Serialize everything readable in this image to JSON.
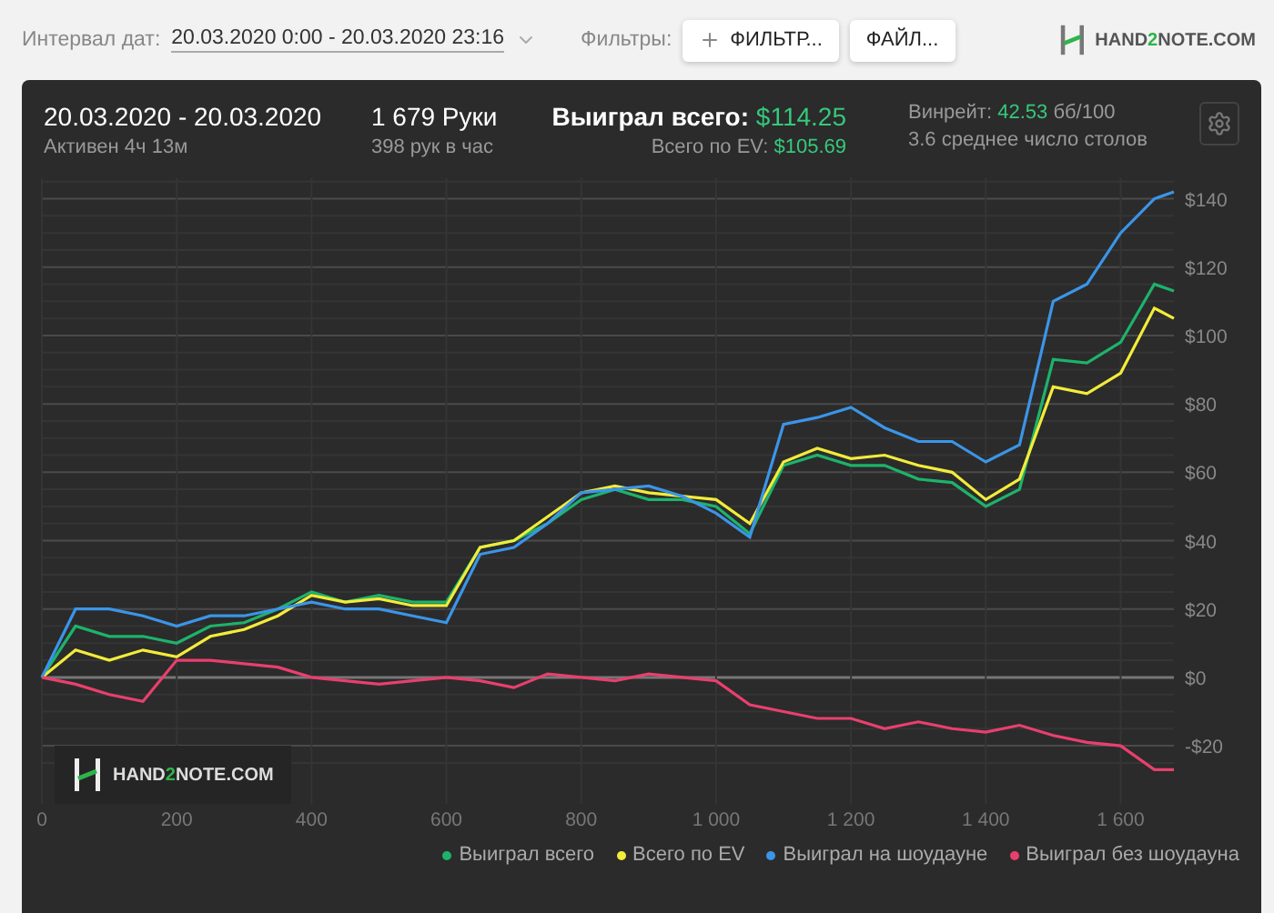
{
  "toolbar": {
    "date_label": "Интервал дат:",
    "date_value": "20.03.2020 0:00 - 20.03.2020 23:16",
    "filters_label": "Фильтры:",
    "filter_button": "ФИЛЬТР...",
    "file_button": "ФАЙЛ..."
  },
  "logo": {
    "before": "HAND",
    "accent": "2",
    "after": "NOTE.COM"
  },
  "summary": {
    "period": "20.03.2020 - 20.03.2020",
    "active": "Активен 4ч 13м",
    "hands": "1 679 Руки",
    "hands_rate": "398 рук в час",
    "won_label": "Выиграл всего:",
    "won_value": "$114.25",
    "ev_label": "Всего по EV:",
    "ev_value": "$105.69",
    "winrate_label": "Винрейт:",
    "winrate_value": "42.53",
    "winrate_unit": "бб/100",
    "tables": "3.6 среднее число столов"
  },
  "chart_watermark": {
    "before": "HAND",
    "accent": "2",
    "after": "NOTE.COM"
  },
  "chart_data": {
    "type": "line",
    "x": [
      0,
      50,
      100,
      150,
      200,
      250,
      300,
      350,
      400,
      450,
      500,
      550,
      600,
      650,
      700,
      750,
      800,
      850,
      900,
      950,
      1000,
      1050,
      1100,
      1150,
      1200,
      1250,
      1300,
      1350,
      1400,
      1450,
      1500,
      1550,
      1600,
      1650,
      1679
    ],
    "xlim": [
      0,
      1679
    ],
    "ylim": [
      -37,
      146
    ],
    "grid": true,
    "xticks": [
      {
        "value": 0,
        "label": "0"
      },
      {
        "value": 200,
        "label": "200"
      },
      {
        "value": 400,
        "label": "400"
      },
      {
        "value": 600,
        "label": "600"
      },
      {
        "value": 800,
        "label": "800"
      },
      {
        "value": 1000,
        "label": "1 000"
      },
      {
        "value": 1200,
        "label": "1 200"
      },
      {
        "value": 1400,
        "label": "1 400"
      },
      {
        "value": 1600,
        "label": "1 600"
      }
    ],
    "yticks": [
      {
        "value": -20,
        "label": "-$20"
      },
      {
        "value": 0,
        "label": "$0"
      },
      {
        "value": 20,
        "label": "$20"
      },
      {
        "value": 40,
        "label": "$40"
      },
      {
        "value": 60,
        "label": "$60"
      },
      {
        "value": 80,
        "label": "$80"
      },
      {
        "value": 100,
        "label": "$100"
      },
      {
        "value": 120,
        "label": "$120"
      },
      {
        "value": 140,
        "label": "$140"
      }
    ],
    "series": [
      {
        "name": "Выиграл всего",
        "color": "#1db36b",
        "values": [
          0,
          15,
          12,
          12,
          10,
          15,
          16,
          20,
          25,
          22,
          24,
          22,
          22,
          38,
          40,
          45,
          52,
          55,
          52,
          52,
          50,
          42,
          62,
          65,
          62,
          62,
          58,
          57,
          50,
          55,
          93,
          92,
          98,
          115,
          113
        ]
      },
      {
        "name": "Всего по EV",
        "color": "#f2ec3a",
        "values": [
          0,
          8,
          5,
          8,
          6,
          12,
          14,
          18,
          24,
          22,
          23,
          21,
          21,
          38,
          40,
          47,
          54,
          56,
          54,
          53,
          52,
          45,
          63,
          67,
          64,
          65,
          62,
          60,
          52,
          58,
          85,
          83,
          89,
          108,
          105
        ]
      },
      {
        "name": "Выиграл на шоудауне",
        "color": "#3b95e8",
        "values": [
          0,
          20,
          20,
          18,
          15,
          18,
          18,
          20,
          22,
          20,
          20,
          18,
          16,
          36,
          38,
          45,
          54,
          55,
          56,
          53,
          48,
          41,
          74,
          76,
          79,
          73,
          69,
          69,
          63,
          68,
          110,
          115,
          130,
          140,
          142
        ]
      },
      {
        "name": "Выиграл без шоудауна",
        "color": "#e8406e",
        "values": [
          0,
          -2,
          -5,
          -7,
          5,
          5,
          4,
          3,
          0,
          -1,
          -2,
          -1,
          0,
          -1,
          -3,
          1,
          0,
          -1,
          1,
          0,
          -1,
          -8,
          -10,
          -12,
          -12,
          -15,
          -13,
          -15,
          -16,
          -14,
          -17,
          -19,
          -20,
          -27,
          -27
        ]
      }
    ]
  }
}
